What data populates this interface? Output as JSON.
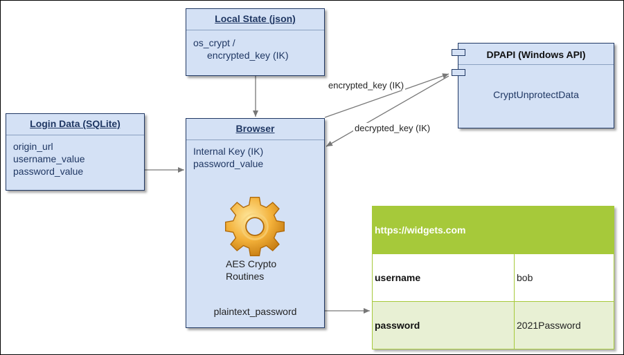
{
  "local_state": {
    "title": "Local State (json)",
    "line1": "os_crypt /",
    "line2": "encrypted_key (IK)"
  },
  "login_data": {
    "title": "Login Data (SQLite)",
    "fields": [
      "origin_url",
      "username_value",
      "password_value"
    ]
  },
  "browser": {
    "title": "Browser",
    "line1": "Internal Key (IK)",
    "line2": "password_value",
    "crypto_line1": "AES Crypto",
    "crypto_line2": "Routines",
    "output": "plaintext_password"
  },
  "dpapi": {
    "title": "DPAPI (Windows API)",
    "function": "CryptUnprotectData"
  },
  "edge_labels": {
    "encrypted": "encrypted_key (IK)",
    "decrypted": "decrypted_key (IK)"
  },
  "result_table": {
    "url": "https://widgets.com",
    "rows": [
      {
        "key": "username",
        "value": "bob"
      },
      {
        "key": "password",
        "value": "2021Password"
      }
    ],
    "header_color": "#a6c93a"
  },
  "colors": {
    "box_fill": "#d4e1f5",
    "box_border": "#1f3763",
    "arrow": "#777777"
  }
}
